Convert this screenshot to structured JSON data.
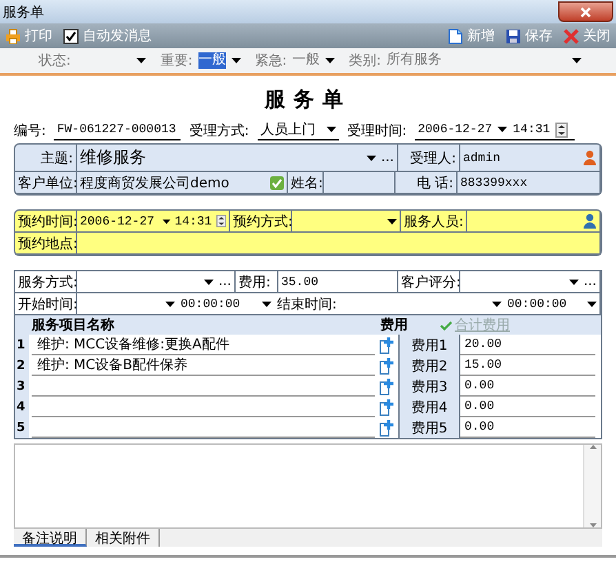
{
  "window": {
    "title": "服务单"
  },
  "toolbar": {
    "print": "打印",
    "auto_message": {
      "label": "自动发消息",
      "checked": true
    },
    "buttons": [
      {
        "label": "新增",
        "kind": "new"
      },
      {
        "label": "保存",
        "kind": "save"
      },
      {
        "label": "关闭",
        "kind": "close"
      }
    ]
  },
  "filters": [
    {
      "label": "状态:",
      "focused": false
    },
    {
      "label": "重要:",
      "value": "一般",
      "focused": true
    },
    {
      "label": "紧急:",
      "value": "一般",
      "focused": false
    },
    {
      "label": "类别:",
      "value": "所有服务",
      "focused": false
    }
  ],
  "form": {
    "heading": "服务单",
    "number": {
      "label": "编号:",
      "value": "FW-061227-000013"
    },
    "accept_method": {
      "label": "受理方式:",
      "value": "人员上门"
    },
    "accept_time": {
      "label": "受理时间:",
      "date": "2006-12-27",
      "time": "14:31"
    }
  },
  "customer": {
    "subject": {
      "label": "主题:",
      "value": "维修服务",
      "more": "..."
    },
    "handler": {
      "label": "受理人:",
      "value": "admin"
    },
    "company": {
      "label": "客户单位:",
      "value": "程度商贸发展公司demo"
    },
    "name": {
      "label": "姓名:"
    },
    "phone": {
      "label": "电  话:",
      "value": "883399xxx"
    }
  },
  "appointment": {
    "time": {
      "label": "预约时间:",
      "date": "2006-12-27",
      "time": "14:31"
    },
    "method": {
      "label": "预约方式:"
    },
    "staff": {
      "label": "服务人员:"
    },
    "place": {
      "label": "预约地点:"
    }
  },
  "service": {
    "method": {
      "label": "服务方式:",
      "more": "..."
    },
    "fee": {
      "label": "费用:",
      "value": "35.00"
    },
    "rating": {
      "label": "客户评分:",
      "more": "..."
    },
    "start": {
      "label": "开始时间:",
      "time": "00:00:00"
    },
    "end": {
      "label": "结束时间:",
      "time": "00:00:00"
    }
  },
  "items": {
    "columns": [
      "服务项目名称",
      "费用"
    ],
    "total_link": "合计费用",
    "rows": [
      {
        "number": "1",
        "name": "维护: MCC设备维修:更换A配件",
        "fee_label": "费用1",
        "fee": "20.00"
      },
      {
        "number": "2",
        "name": "维护: MC设备B配件保养",
        "fee_label": "费用2",
        "fee": "15.00"
      },
      {
        "number": "3",
        "fee_label": "费用3",
        "fee": "0.00"
      },
      {
        "number": "4",
        "fee_label": "费用4",
        "fee": "0.00"
      },
      {
        "number": "5",
        "fee_label": "费用5",
        "fee": "0.00"
      }
    ]
  },
  "tabs": [
    {
      "label": "备注说明",
      "selected": true
    },
    {
      "label": "相关附件",
      "selected": false
    }
  ]
}
